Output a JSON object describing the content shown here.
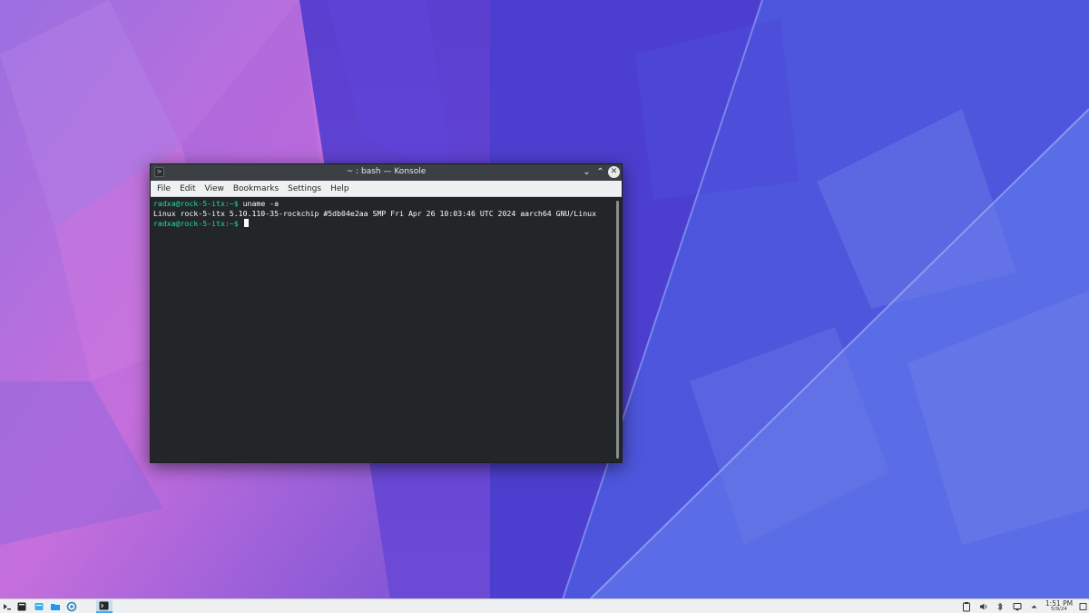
{
  "window": {
    "title": "~ : bash — Konsole",
    "app_icon": ">"
  },
  "menubar": {
    "items": [
      "File",
      "Edit",
      "View",
      "Bookmarks",
      "Settings",
      "Help"
    ]
  },
  "terminal": {
    "line1_prompt": "radxa@rock-5-itx:~$",
    "line1_command": " uname -a",
    "line2_output": "Linux rock-5-itx 5.10.110-35-rockchip #5db04e2aa SMP Fri Apr 26 10:03:46 UTC 2024 aarch64 GNU/Linux",
    "line3_prompt": "radxa@rock-5-itx:~$"
  },
  "taskbar": {
    "clock_time": "1:51 PM",
    "clock_date": "5/9/24"
  },
  "colors": {
    "terminal_bg": "#232629",
    "prompt_green": "#1cdc9a",
    "titlebar": "#3b4045",
    "accent": "#3daee9"
  },
  "icons": {
    "launcher": "app-launcher-icon",
    "task_show_desktop": "show-desktop-icon",
    "task_files": "file-manager-icon",
    "task_folder": "folder-icon",
    "task_browser": "browser-icon",
    "task_konsole": "konsole-icon",
    "tray_clipboard": "clipboard-icon",
    "tray_volume": "volume-icon",
    "tray_bluetooth": "bluetooth-icon",
    "tray_network": "network-icon",
    "tray_expand": "tray-expand-icon",
    "peek": "peek-desktop-icon"
  }
}
